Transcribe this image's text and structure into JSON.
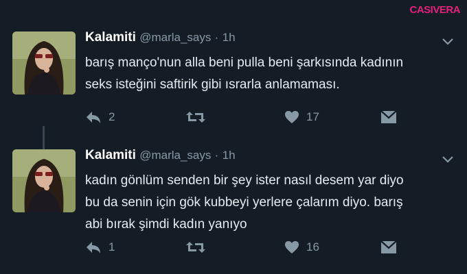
{
  "watermark": "CASIVERA",
  "tweets": [
    {
      "name": "Kalamiti",
      "handle": "@marla_says",
      "dot": "·",
      "time": "1h",
      "lines": [
        "barış manço'nun alla beni pulla beni şarkısında kadının",
        "seks isteğini saftirik gibi ısrarla anlamaması."
      ],
      "replies": "2",
      "retweets": "",
      "likes": "17"
    },
    {
      "name": "Kalamiti",
      "handle": "@marla_says",
      "dot": "·",
      "time": "1h",
      "lines": [
        "kadın gönlüm senden bir şey ister nasıl desem yar diyo",
        "bu da senin için gök kubbeyi yerlere çalarım diyo. barış",
        "abi bırak şimdi kadın yanıyo"
      ],
      "replies": "1",
      "retweets": "",
      "likes": "16"
    }
  ],
  "icons": {
    "reply": "reply-icon",
    "retweet": "retweet-icon",
    "like": "heart-icon",
    "dm": "direct-message-icon",
    "more": "chevron-down-icon"
  },
  "colors": {
    "background": "#141d26",
    "muted": "#8899a6",
    "text": "#e6ebef",
    "watermark": "#e4217c"
  }
}
